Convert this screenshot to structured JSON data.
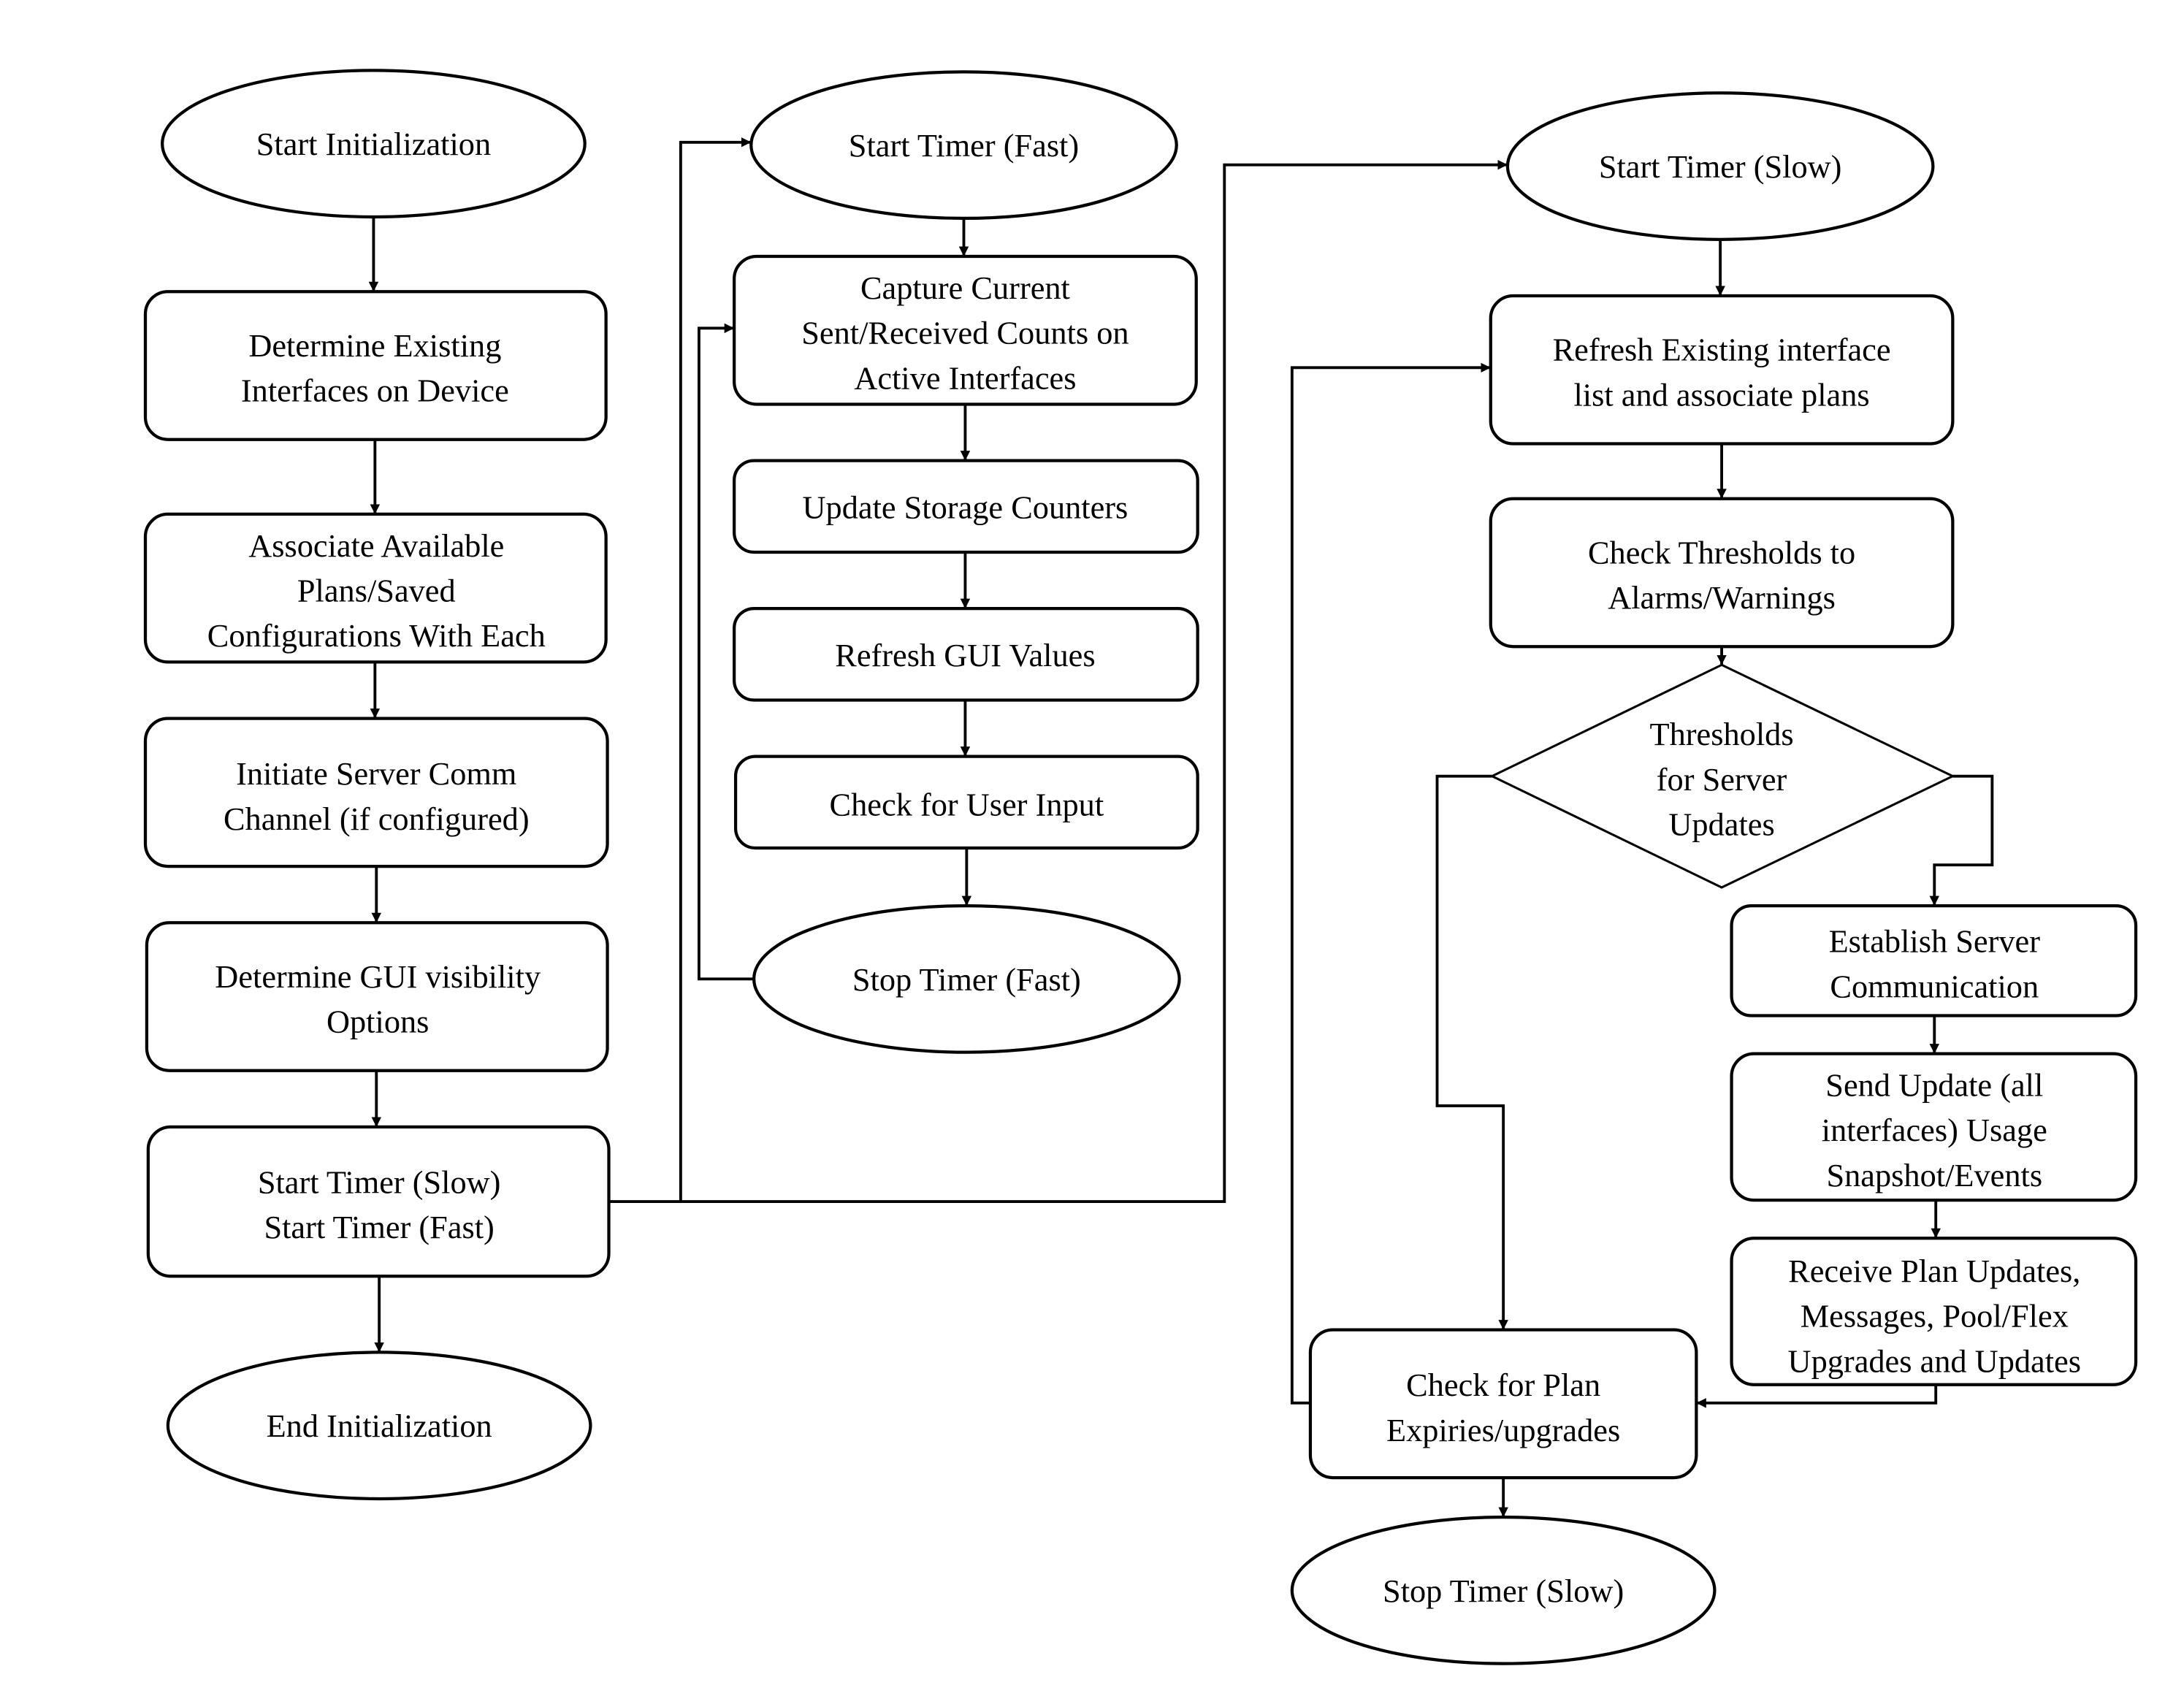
{
  "diagram": {
    "columns": {
      "initialization": {
        "start": "Start Initialization",
        "steps": [
          [
            "Determine Existing",
            "Interfaces on Device"
          ],
          [
            "Associate Available",
            "Plans/Saved",
            "Configurations With Each"
          ],
          [
            "Initiate Server Comm",
            "Channel (if configured)"
          ],
          [
            "Determine GUI visibility",
            "Options"
          ],
          [
            "Start Timer (Slow)",
            "Start Timer (Fast)"
          ]
        ],
        "end": "End Initialization"
      },
      "fast_timer": {
        "start": "Start Timer (Fast)",
        "steps": [
          [
            "Capture Current",
            "Sent/Received Counts on",
            "Active Interfaces"
          ],
          [
            "Update Storage Counters"
          ],
          [
            "Refresh GUI Values"
          ],
          [
            "Check for User Input"
          ]
        ],
        "end": "Stop Timer (Fast)"
      },
      "slow_timer": {
        "start": "Start Timer (Slow)",
        "steps": [
          [
            "Refresh Existing interface",
            "list and associate plans"
          ],
          [
            "Check Thresholds to",
            "Alarms/Warnings"
          ]
        ],
        "decision": [
          "Thresholds",
          "for Server",
          "Updates"
        ],
        "server_steps": [
          [
            "Establish Server",
            "Communication"
          ],
          [
            "Send Update (all",
            "interfaces) Usage",
            "Snapshot/Events"
          ],
          [
            "Receive Plan Updates,",
            "Messages, Pool/Flex",
            "Upgrades and Updates"
          ]
        ],
        "check_plan": [
          "Check for Plan",
          "Expiries/upgrades"
        ],
        "end": "Stop Timer (Slow)"
      }
    }
  }
}
